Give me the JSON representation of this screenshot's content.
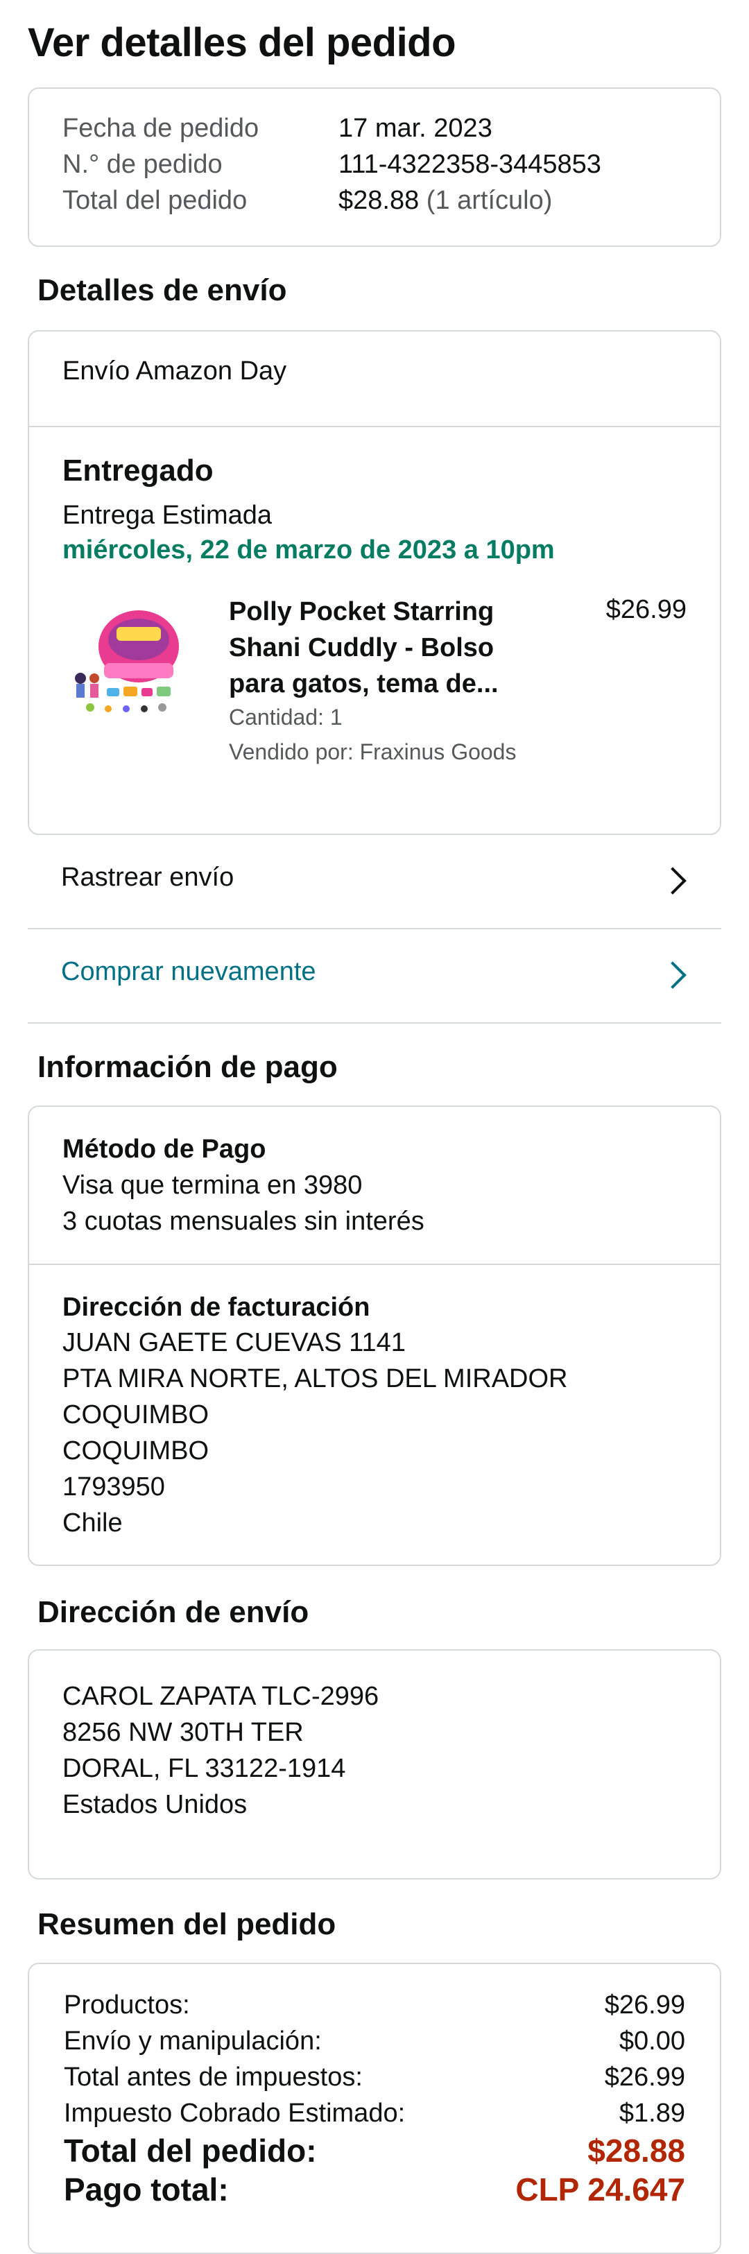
{
  "page_title": "Ver detalles del pedido",
  "order_info": {
    "date_label": "Fecha de pedido",
    "date_value": "17 mar. 2023",
    "number_label": "N.° de pedido",
    "number_value": "111-4322358-3445853",
    "total_label": "Total del pedido",
    "total_value": "$28.88",
    "total_items": "(1 artículo)"
  },
  "shipping_details": {
    "section_title": "Detalles de envío",
    "method": "Envío Amazon Day",
    "status": "Entregado",
    "estimate_label": "Entrega Estimada",
    "estimate_value": "miércoles, 22 de marzo de 2023 a 10pm",
    "product": {
      "title_line1": "Polly Pocket Starring",
      "title_line2": "Shani Cuddly - Bolso",
      "title_line3": "para gatos, tema de...",
      "price": "$26.99",
      "quantity": "Cantidad: 1",
      "seller": "Vendido por: Fraxinus Goods"
    },
    "track_label": "Rastrear envío",
    "buy_again_label": "Comprar nuevamente"
  },
  "payment": {
    "section_title": "Información de pago",
    "method_title": "Método de Pago",
    "card": "Visa que termina en 3980",
    "installments": "3 cuotas mensuales sin interés",
    "billing_title": "Dirección de facturación",
    "billing_lines": [
      "JUAN GAETE CUEVAS 1141",
      "PTA MIRA NORTE, ALTOS DEL MIRADOR",
      "COQUIMBO",
      "COQUIMBO",
      "1793950",
      "Chile"
    ]
  },
  "shipping_address": {
    "section_title": "Dirección de envío",
    "lines": [
      "CAROL ZAPATA TLC-2996",
      "8256 NW 30TH TER",
      "DORAL, FL 33122-1914",
      "Estados Unidos"
    ]
  },
  "summary": {
    "section_title": "Resumen del pedido",
    "rows": [
      {
        "label": "Productos:",
        "value": "$26.99"
      },
      {
        "label": "Envío y manipulación:",
        "value": "$0.00"
      },
      {
        "label": "Total antes de impuestos:",
        "value": "$26.99"
      },
      {
        "label": "Impuesto Cobrado Estimado:",
        "value": "$1.89"
      }
    ],
    "order_total_label": "Total del pedido:",
    "order_total_value": "$28.88",
    "paid_total_label": "Pago total:",
    "paid_total_value": "CLP 24.647"
  },
  "colors": {
    "accent_green": "#067d62",
    "link": "#007185",
    "price_red": "#b12704",
    "border": "#d5d9d9"
  },
  "icons": [
    "chevron-right-icon",
    "product-image"
  ]
}
